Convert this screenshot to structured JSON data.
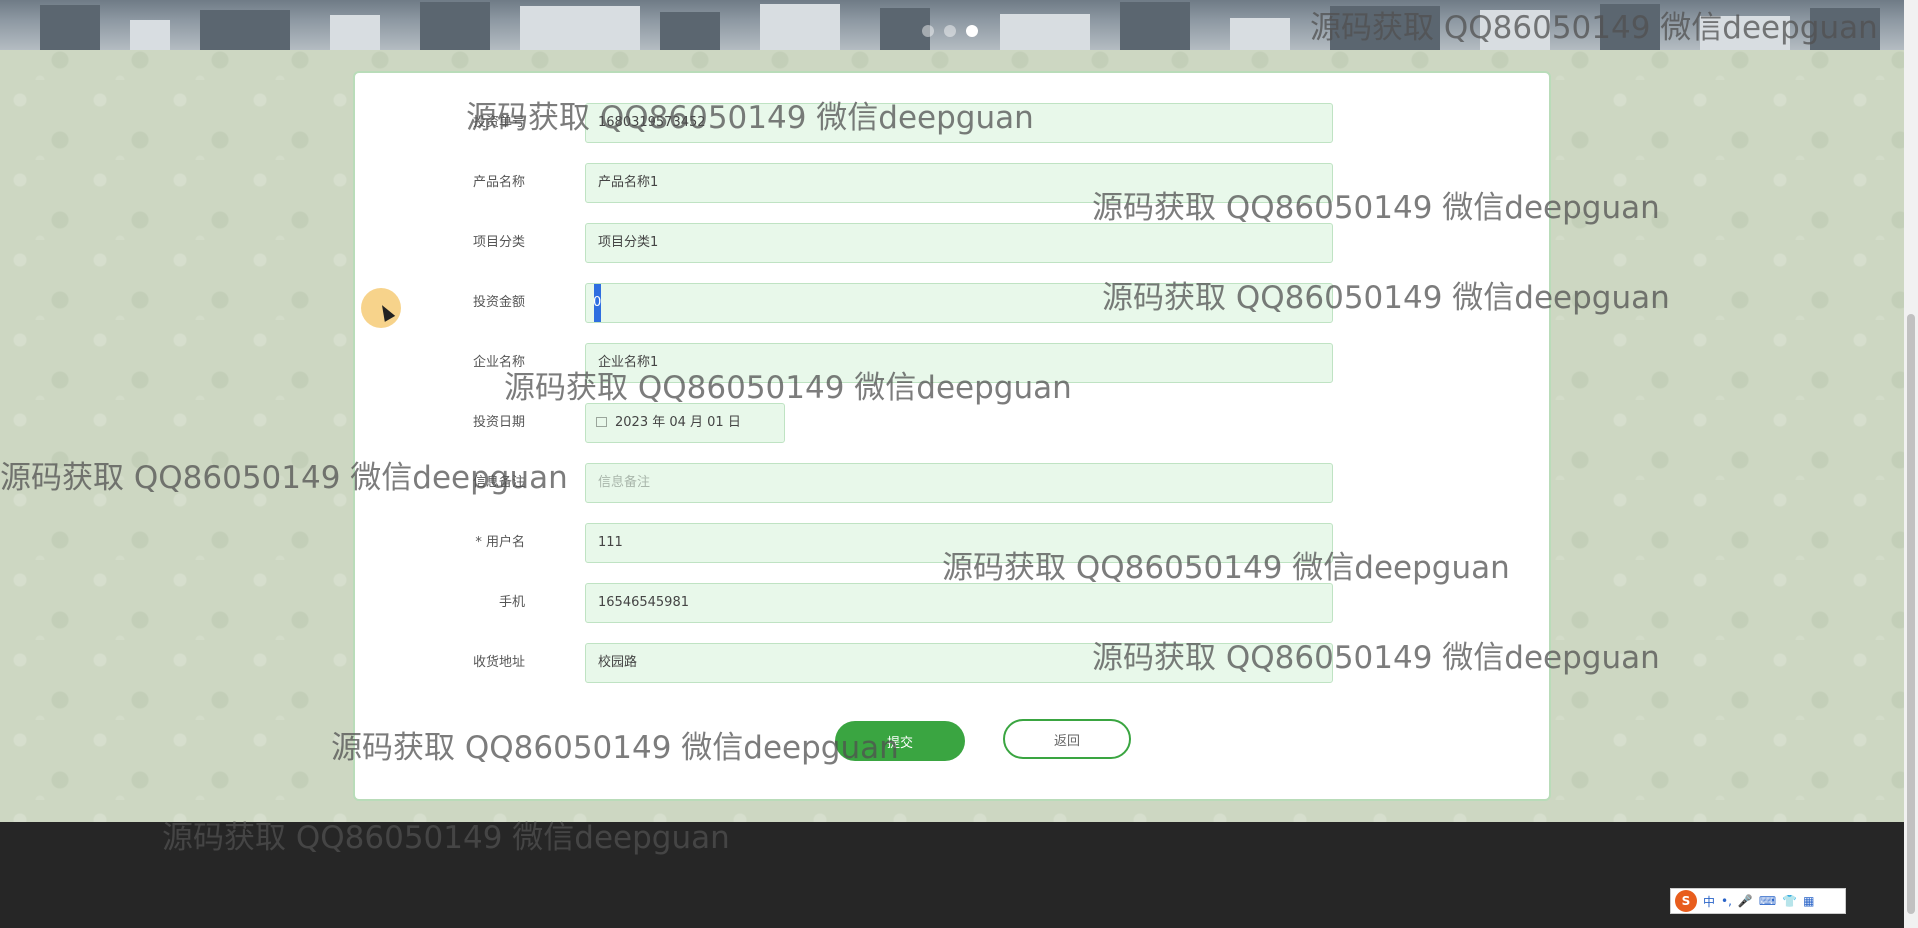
{
  "banner": {
    "slides": 3,
    "active_slide": 3
  },
  "form": {
    "fields": [
      {
        "label": "投资单号",
        "value": "1680319573452",
        "placeholder": false
      },
      {
        "label": "产品名称",
        "value": "产品名称1",
        "placeholder": false
      },
      {
        "label": "项目分类",
        "value": "项目分类1",
        "placeholder": false
      },
      {
        "label": "投资金额",
        "value": "0",
        "placeholder": false
      },
      {
        "label": "企业名称",
        "value": "企业名称1",
        "placeholder": false
      },
      {
        "label": "投资日期",
        "value": "2023 年 04 月 01 日",
        "placeholder": false
      },
      {
        "label": "信息备注",
        "value": "信息备注",
        "placeholder": true
      },
      {
        "label": "* 用户名",
        "value": "111",
        "placeholder": false
      },
      {
        "label": "手机",
        "value": "16546545981",
        "placeholder": false
      },
      {
        "label": "收货地址",
        "value": "校园路",
        "placeholder": false
      }
    ],
    "submit_label": "提交",
    "back_label": "返回"
  },
  "watermark": "源码获取 QQ86050149 微信deepguan",
  "ime": {
    "logo": "S",
    "items": [
      "中",
      "•,",
      "🎤",
      "⌨",
      "👕",
      "▦"
    ]
  },
  "colors": {
    "accent": "#3aa541",
    "input_bg": "#e8f8ea",
    "footer": "#262626"
  }
}
